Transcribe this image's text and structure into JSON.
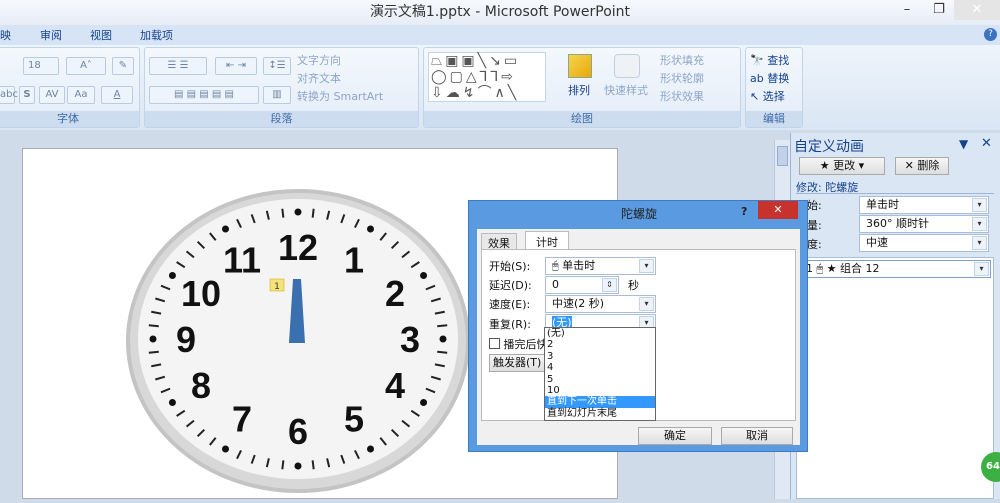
{
  "window": {
    "title": "演示文稿1.pptx - Microsoft PowerPoint",
    "minimize": "–",
    "restore": "❐",
    "close": "✕",
    "help": "?"
  },
  "tabs": [
    "映",
    "审阅",
    "视图",
    "加载项"
  ],
  "ribbon": {
    "font": {
      "label": "字体",
      "size": "18",
      "grow": "A˄",
      "shrink": "A˅",
      "strike": "abc",
      "shadow": "S",
      "spacing": "AV",
      "case": "Aa",
      "color": "A"
    },
    "paragraph": {
      "label": "段落",
      "text_direction": "文字方向",
      "align_text": "对齐文本",
      "smartart": "转换为 SmartArt"
    },
    "drawing": {
      "label": "绘图",
      "arrange": "排列",
      "quick_styles": "快速样式",
      "fill": "形状填充",
      "outline": "形状轮廓",
      "effects": "形状效果"
    },
    "editing": {
      "label": "编辑",
      "find": "查找",
      "replace": "替换",
      "select": "选择"
    }
  },
  "clock": {
    "numbers": [
      "12",
      "1",
      "2",
      "3",
      "4",
      "5",
      "6",
      "7",
      "8",
      "9",
      "10",
      "11"
    ],
    "tag": "1"
  },
  "pane": {
    "title": "自定义动画",
    "change": "更改",
    "remove": "删除",
    "modify": "修改: 陀螺旋",
    "start_label": "开始:",
    "start_value": "单击时",
    "amount_label": "数量:",
    "amount_value": "360°  顺时针",
    "speed_label": "速度:",
    "speed_value": "中速",
    "item_index": "1",
    "item_name": "组合 12"
  },
  "dialog": {
    "title": "陀螺旋",
    "tabs": [
      "效果",
      "计时"
    ],
    "start_label": "开始(S):",
    "start_value": "单击时",
    "delay_label": "延迟(D):",
    "delay_value": "0",
    "delay_unit": "秒",
    "speed_label": "速度(E):",
    "speed_value": "中速(2 秒)",
    "repeat_label": "重复(R):",
    "repeat_value": "(无)",
    "rewind_label": "播完后快退(W)",
    "trigger": "触发器(T)",
    "repeat_options": [
      "(无)",
      "2",
      "3",
      "4",
      "5",
      "10",
      "直到下一次单击",
      "直到幻灯片末尾"
    ],
    "ok": "确定",
    "cancel": "取消"
  },
  "badge": "64"
}
